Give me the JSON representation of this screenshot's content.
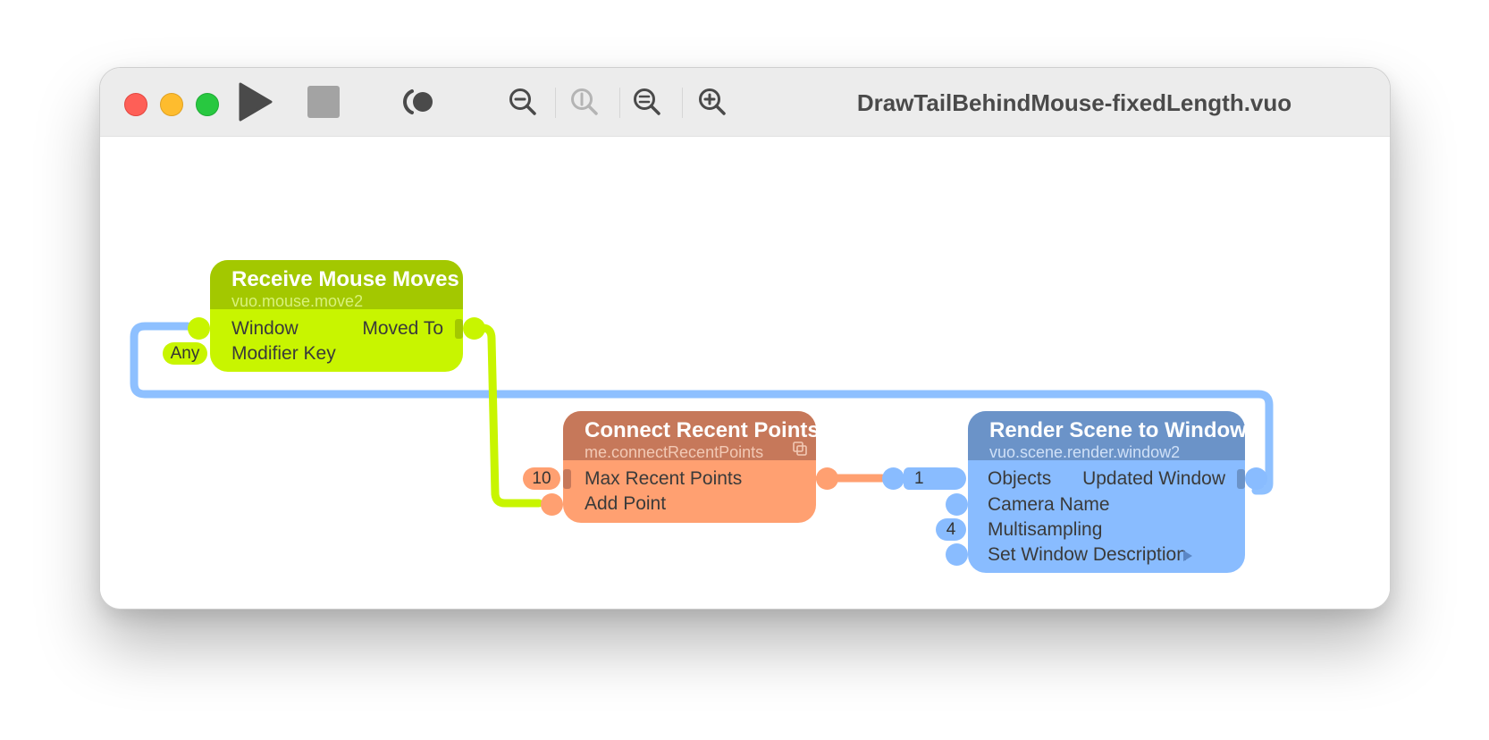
{
  "window": {
    "title": "DrawTailBehindMouse-fixedLength.vuo"
  },
  "toolbar": {
    "buttons": [
      {
        "name": "run",
        "icon": "play-icon"
      },
      {
        "name": "stop",
        "icon": "stop-icon"
      },
      {
        "name": "show-events",
        "icon": "show-events-icon"
      },
      {
        "name": "zoom-out",
        "icon": "zoom-out-icon"
      },
      {
        "name": "actual-size",
        "icon": "zoom-actual-size-icon"
      },
      {
        "name": "zoom-to-fit",
        "icon": "zoom-to-fit-icon"
      },
      {
        "name": "zoom-in",
        "icon": "zoom-in-icon"
      }
    ]
  },
  "colors": {
    "mouse_node_body": "#c8f500",
    "mouse_node_header": "#a3c800",
    "connect_node_body": "#ffa071",
    "connect_node_header": "#c6785a",
    "render_node_body": "#89bcff",
    "render_node_header": "#6b93c8",
    "wire_blue": "#8ec0ff",
    "wire_green": "#c8f500",
    "wire_orange": "#ffa071"
  },
  "nodes": {
    "mouse": {
      "title": "Receive Mouse Moves",
      "class_name": "vuo.mouse.move2",
      "inputs": [
        {
          "label": "Window"
        },
        {
          "label": "Modifier Key",
          "constant": "Any"
        }
      ],
      "outputs": [
        {
          "label": "Moved To"
        }
      ]
    },
    "connect": {
      "title": "Connect Recent Points",
      "class_name": "me.connectRecentPoints",
      "inputs": [
        {
          "label": "Max Recent Points",
          "constant": "10"
        },
        {
          "label": "Add Point"
        }
      ]
    },
    "render": {
      "title": "Render Scene to Window",
      "class_name": "vuo.scene.render.window2",
      "inputs": [
        {
          "label": "Objects",
          "constant": "1"
        },
        {
          "label": "Camera Name"
        },
        {
          "label": "Multisampling",
          "constant": "4"
        },
        {
          "label": "Set Window Description"
        }
      ],
      "outputs": [
        {
          "label": "Updated Window"
        }
      ]
    }
  }
}
